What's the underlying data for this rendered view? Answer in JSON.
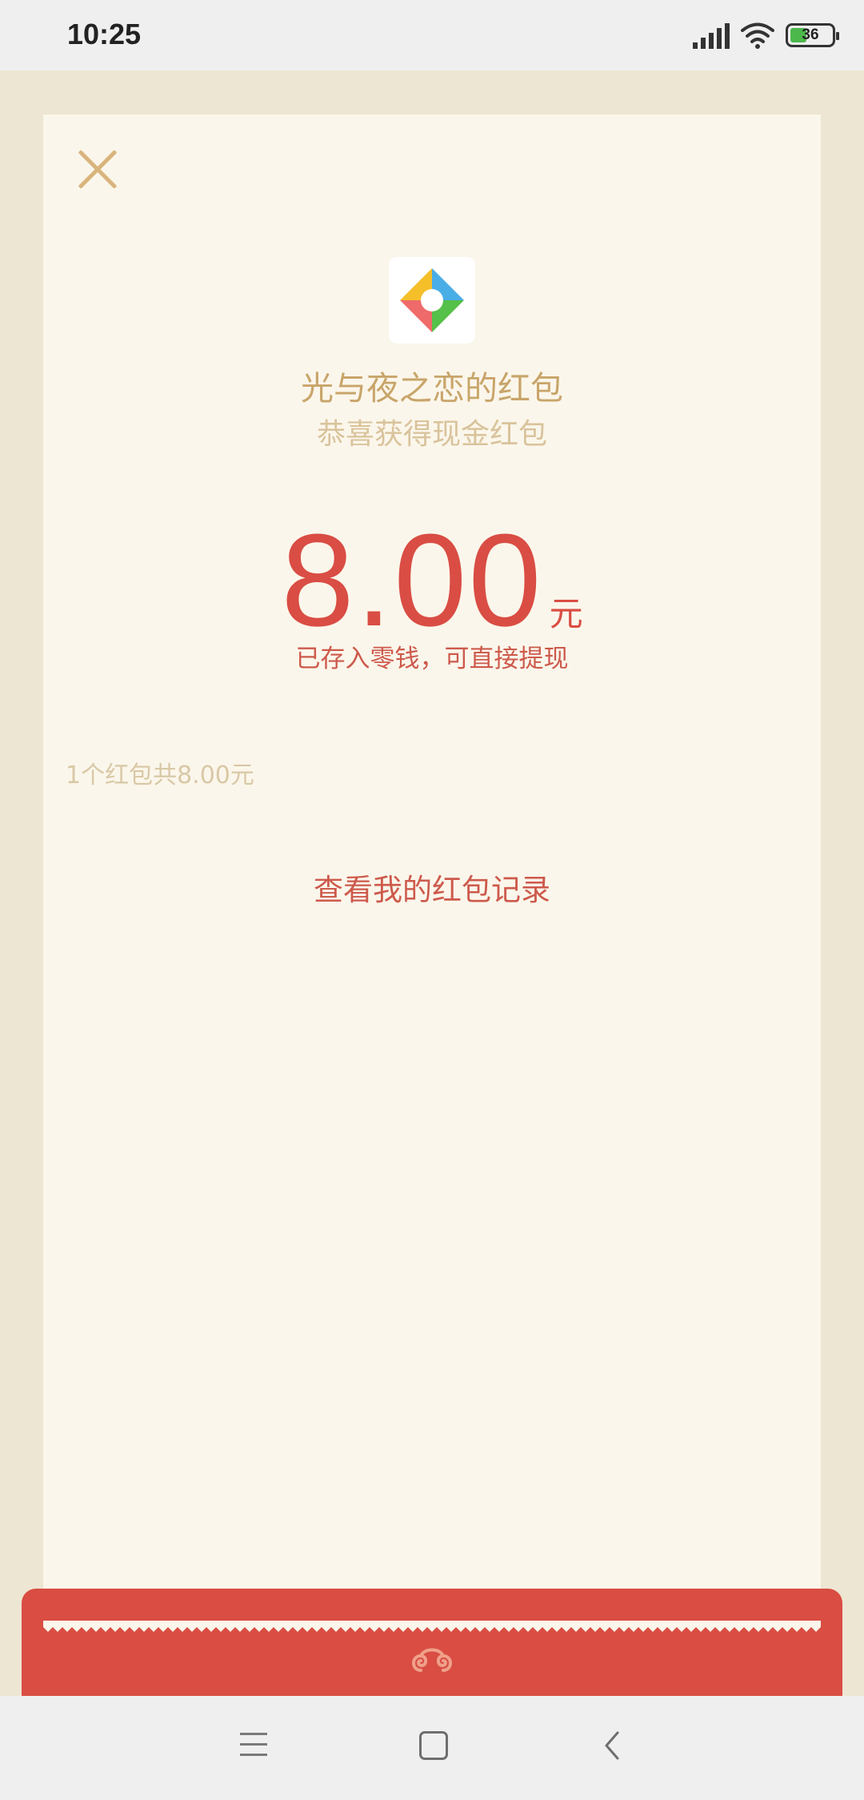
{
  "status_bar": {
    "time": "10:25",
    "battery": "36"
  },
  "card": {
    "title": "光与夜之恋的红包",
    "subtitle": "恭喜获得现金红包",
    "amount": "8.00",
    "unit": "元",
    "stored_note": "已存入零钱，可直接提现",
    "summary": "1个红包共8.00元",
    "record_link": "查看我的红包记录"
  },
  "colors": {
    "background": "#ede6d3",
    "card": "#fbf6eb",
    "accent_red": "#d94d44",
    "gold": "#c8a56a"
  },
  "icons": {
    "close": "close-icon",
    "logo": "app-logo-icon",
    "nav_menu": "menu-icon",
    "nav_home": "home-icon",
    "nav_back": "back-icon"
  }
}
